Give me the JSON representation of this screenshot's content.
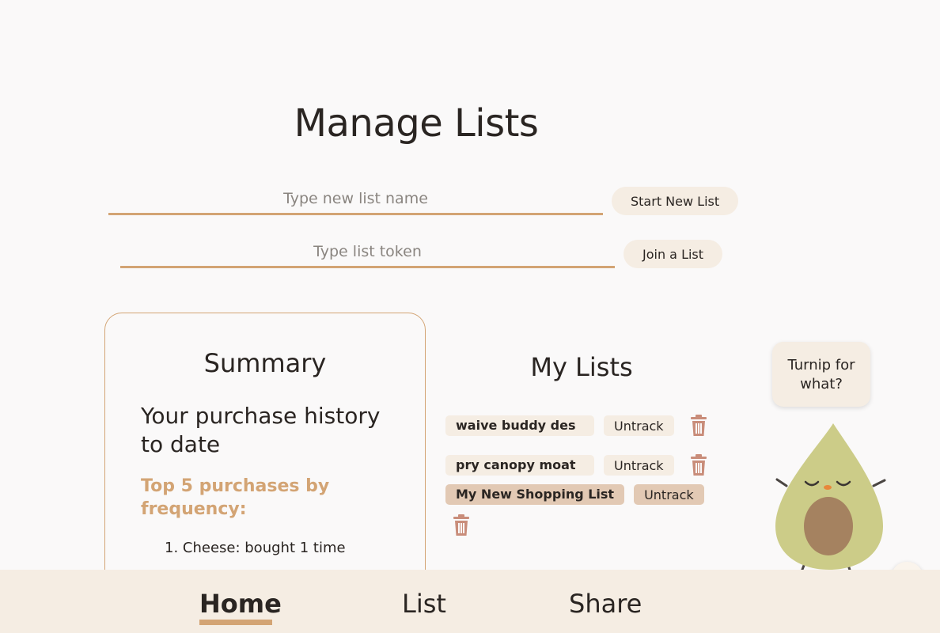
{
  "page": {
    "title": "Manage Lists"
  },
  "new_list": {
    "placeholder": "Type new list name",
    "value": "",
    "button_label": "Start New List"
  },
  "join_list": {
    "placeholder": "Type list token",
    "value": "",
    "button_label": "Join a List"
  },
  "summary": {
    "title": "Summary",
    "history_title": "Your purchase history to date",
    "top_title": "Top 5 purchases by frequency:",
    "items": [
      "1. Cheese: bought 1 time"
    ]
  },
  "my_lists": {
    "title": "My Lists",
    "lists": [
      {
        "name": "waive buddy des",
        "untrack_label": "Untrack",
        "trash_icon": "trash-icon"
      },
      {
        "name": "pry canopy moat",
        "untrack_label": "Untrack",
        "trash_icon": "trash-icon"
      },
      {
        "name": "My New Shopping List",
        "untrack_label": "Untrack",
        "trash_icon": "trash-icon",
        "active": true
      }
    ]
  },
  "mascot": {
    "bubble_text": "Turnip for what?",
    "icon": "avocado-mascot",
    "close_label": "x"
  },
  "nav": {
    "items": [
      {
        "label": "Home",
        "active": true
      },
      {
        "label": "List",
        "active": false
      },
      {
        "label": "Share",
        "active": false
      }
    ]
  },
  "colors": {
    "accent": "#d3a474",
    "background": "#faf9f9",
    "pill": "#f5ede3",
    "active_pill": "#e2c9b4",
    "trash": "#c98d7a",
    "avocado_skin": "#cccc88",
    "avocado_pit": "#a58260"
  }
}
